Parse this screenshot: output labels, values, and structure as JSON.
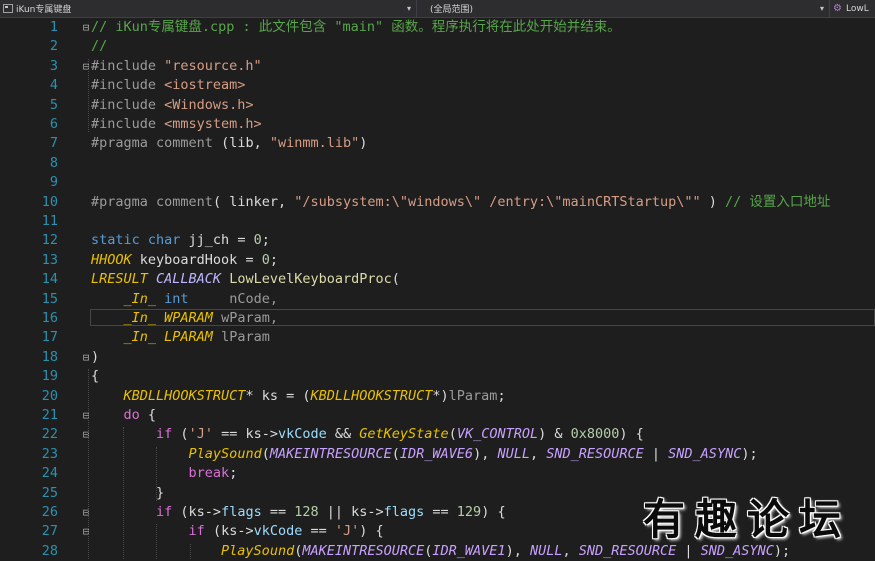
{
  "navbar": {
    "project": "iKun专属键盘",
    "scope": "(全局范围)",
    "function": "LowL"
  },
  "colors": {
    "background": "#1e1e1e",
    "line_number": "#2b91af",
    "comment": "#57a64a",
    "keyword": "#569cd6",
    "string": "#d69d85"
  },
  "lines": [
    {
      "n": "1",
      "fold": "⊟",
      "tokens": [
        {
          "t": "// iKun专属键盘.cpp : 此文件包含 \"main\" 函数。程序执行将在此处开始并结束。",
          "c": "c"
        }
      ]
    },
    {
      "n": "2",
      "fold": "",
      "tokens": [
        {
          "t": "//",
          "c": "c"
        }
      ]
    },
    {
      "n": "3",
      "fold": "⊟",
      "tokens": [
        {
          "t": "#include ",
          "c": "pp"
        },
        {
          "t": "\"resource.h\"",
          "c": "s"
        }
      ]
    },
    {
      "n": "4",
      "fold": "",
      "tokens": [
        {
          "t": "#include ",
          "c": "pp"
        },
        {
          "t": "<iostream>",
          "c": "s"
        }
      ]
    },
    {
      "n": "5",
      "fold": "",
      "tokens": [
        {
          "t": "#include ",
          "c": "pp"
        },
        {
          "t": "<Windows.h>",
          "c": "s"
        }
      ]
    },
    {
      "n": "6",
      "fold": "",
      "tokens": [
        {
          "t": "#include ",
          "c": "pp"
        },
        {
          "t": "<mmsystem.h>",
          "c": "s"
        }
      ]
    },
    {
      "n": "7",
      "fold": "",
      "tokens": [
        {
          "t": "#pragma ",
          "c": "pp"
        },
        {
          "t": "comment ",
          "c": "pp"
        },
        {
          "t": "(lib, ",
          "c": ""
        },
        {
          "t": "\"winmm.lib\"",
          "c": "s"
        },
        {
          "t": ")",
          "c": ""
        }
      ]
    },
    {
      "n": "8",
      "fold": "",
      "tokens": []
    },
    {
      "n": "9",
      "fold": "",
      "tokens": []
    },
    {
      "n": "10",
      "fold": "",
      "tokens": [
        {
          "t": "#pragma ",
          "c": "pp"
        },
        {
          "t": "comment",
          "c": "pp"
        },
        {
          "t": "( linker, ",
          "c": ""
        },
        {
          "t": "\"/subsystem:\\\"windows\\\" /entry:\\\"mainCRTStartup\\\"\"",
          "c": "s"
        },
        {
          "t": " ) ",
          "c": ""
        },
        {
          "t": "// 设置入口地址",
          "c": "c"
        }
      ]
    },
    {
      "n": "11",
      "fold": "",
      "tokens": []
    },
    {
      "n": "12",
      "fold": "",
      "tokens": [
        {
          "t": "static ",
          "c": "k"
        },
        {
          "t": "char ",
          "c": "k"
        },
        {
          "t": "jj_ch = ",
          "c": ""
        },
        {
          "t": "0",
          "c": "n"
        },
        {
          "t": ";",
          "c": ""
        }
      ]
    },
    {
      "n": "13",
      "fold": "",
      "tokens": [
        {
          "t": "HHOOK ",
          "c": "y"
        },
        {
          "t": "keyboardHook = ",
          "c": ""
        },
        {
          "t": "0",
          "c": "n"
        },
        {
          "t": ";",
          "c": ""
        }
      ]
    },
    {
      "n": "14",
      "fold": "",
      "tokens": [
        {
          "t": "LRESULT ",
          "c": "y"
        },
        {
          "t": "CALLBACK ",
          "c": "m"
        },
        {
          "t": "LowLevelKeyboardProc",
          "c": "f"
        },
        {
          "t": "(",
          "c": ""
        }
      ]
    },
    {
      "n": "15",
      "fold": "",
      "tokens": [
        {
          "t": "    ",
          "c": ""
        },
        {
          "t": "_In_ ",
          "c": "y"
        },
        {
          "t": "int     ",
          "c": "k"
        },
        {
          "t": "nCode,",
          "c": "p"
        }
      ]
    },
    {
      "n": "16",
      "fold": "",
      "tokens": [
        {
          "t": "    ",
          "c": ""
        },
        {
          "t": "_In_ ",
          "c": "y"
        },
        {
          "t": "WPARAM ",
          "c": "y"
        },
        {
          "t": "wParam,",
          "c": "p"
        }
      ]
    },
    {
      "n": "17",
      "fold": "",
      "tokens": [
        {
          "t": "    ",
          "c": ""
        },
        {
          "t": "_In_ ",
          "c": "y"
        },
        {
          "t": "LPARAM ",
          "c": "y"
        },
        {
          "t": "lParam",
          "c": "p"
        }
      ]
    },
    {
      "n": "18",
      "fold": "⊟",
      "tokens": [
        {
          "t": ")",
          "c": ""
        }
      ]
    },
    {
      "n": "19",
      "fold": "",
      "tokens": [
        {
          "t": "{",
          "c": ""
        }
      ]
    },
    {
      "n": "20",
      "fold": "",
      "tokens": [
        {
          "t": "    ",
          "c": ""
        },
        {
          "t": "KBDLLHOOKSTRUCT",
          "c": "y"
        },
        {
          "t": "* ks = (",
          "c": ""
        },
        {
          "t": "KBDLLHOOKSTRUCT",
          "c": "y"
        },
        {
          "t": "*)",
          "c": ""
        },
        {
          "t": "lParam",
          "c": "p"
        },
        {
          "t": ";",
          "c": ""
        }
      ]
    },
    {
      "n": "21",
      "fold": "⊟",
      "tokens": [
        {
          "t": "    ",
          "c": ""
        },
        {
          "t": "do ",
          "c": "mb"
        },
        {
          "t": "{",
          "c": ""
        }
      ]
    },
    {
      "n": "22",
      "fold": "⊟",
      "tokens": [
        {
          "t": "        ",
          "c": ""
        },
        {
          "t": "if ",
          "c": "mb"
        },
        {
          "t": "(",
          "c": ""
        },
        {
          "t": "'J'",
          "c": "s"
        },
        {
          "t": " == ks->",
          "c": ""
        },
        {
          "t": "vkCode",
          "c": "v"
        },
        {
          "t": " && ",
          "c": ""
        },
        {
          "t": "GetKeyState",
          "c": "y"
        },
        {
          "t": "(",
          "c": ""
        },
        {
          "t": "VK_CONTROL",
          "c": "ma"
        },
        {
          "t": ") & ",
          "c": ""
        },
        {
          "t": "0x8000",
          "c": "n"
        },
        {
          "t": ") {",
          "c": ""
        }
      ]
    },
    {
      "n": "23",
      "fold": "",
      "tokens": [
        {
          "t": "            ",
          "c": ""
        },
        {
          "t": "PlaySound",
          "c": "y"
        },
        {
          "t": "(",
          "c": ""
        },
        {
          "t": "MAKEINTRESOURCE",
          "c": "ma"
        },
        {
          "t": "(",
          "c": ""
        },
        {
          "t": "IDR_WAVE6",
          "c": "ma"
        },
        {
          "t": "), ",
          "c": ""
        },
        {
          "t": "NULL",
          "c": "ma"
        },
        {
          "t": ", ",
          "c": ""
        },
        {
          "t": "SND_RESOURCE",
          "c": "ma"
        },
        {
          "t": " | ",
          "c": ""
        },
        {
          "t": "SND_ASYNC",
          "c": "ma"
        },
        {
          "t": ");",
          "c": ""
        }
      ]
    },
    {
      "n": "24",
      "fold": "",
      "tokens": [
        {
          "t": "            ",
          "c": ""
        },
        {
          "t": "break",
          "c": "mb"
        },
        {
          "t": ";",
          "c": ""
        }
      ]
    },
    {
      "n": "25",
      "fold": "",
      "tokens": [
        {
          "t": "        }",
          "c": ""
        }
      ]
    },
    {
      "n": "26",
      "fold": "⊟",
      "tokens": [
        {
          "t": "        ",
          "c": ""
        },
        {
          "t": "if ",
          "c": "mb"
        },
        {
          "t": "(ks->",
          "c": ""
        },
        {
          "t": "flags",
          "c": "v"
        },
        {
          "t": " == ",
          "c": ""
        },
        {
          "t": "128",
          "c": "n"
        },
        {
          "t": " || ks->",
          "c": ""
        },
        {
          "t": "flags",
          "c": "v"
        },
        {
          "t": " == ",
          "c": ""
        },
        {
          "t": "129",
          "c": "n"
        },
        {
          "t": ") {",
          "c": ""
        }
      ]
    },
    {
      "n": "27",
      "fold": "⊟",
      "tokens": [
        {
          "t": "            ",
          "c": ""
        },
        {
          "t": "if ",
          "c": "mb"
        },
        {
          "t": "(ks->",
          "c": ""
        },
        {
          "t": "vkCode",
          "c": "v"
        },
        {
          "t": " == ",
          "c": ""
        },
        {
          "t": "'J'",
          "c": "s"
        },
        {
          "t": ") {",
          "c": ""
        }
      ]
    },
    {
      "n": "28",
      "fold": "",
      "tokens": [
        {
          "t": "                ",
          "c": ""
        },
        {
          "t": "PlaySound",
          "c": "y"
        },
        {
          "t": "(",
          "c": ""
        },
        {
          "t": "MAKEINTRESOURCE",
          "c": "ma"
        },
        {
          "t": "(",
          "c": ""
        },
        {
          "t": "IDR_WAVE1",
          "c": "ma"
        },
        {
          "t": "), ",
          "c": ""
        },
        {
          "t": "NULL",
          "c": "ma"
        },
        {
          "t": ", ",
          "c": ""
        },
        {
          "t": "SND_RESOURCE",
          "c": "ma"
        },
        {
          "t": " | ",
          "c": ""
        },
        {
          "t": "SND_ASYNC",
          "c": "ma"
        },
        {
          "t": ");",
          "c": ""
        }
      ]
    }
  ],
  "current_line": "16",
  "watermark": "有趣论坛"
}
